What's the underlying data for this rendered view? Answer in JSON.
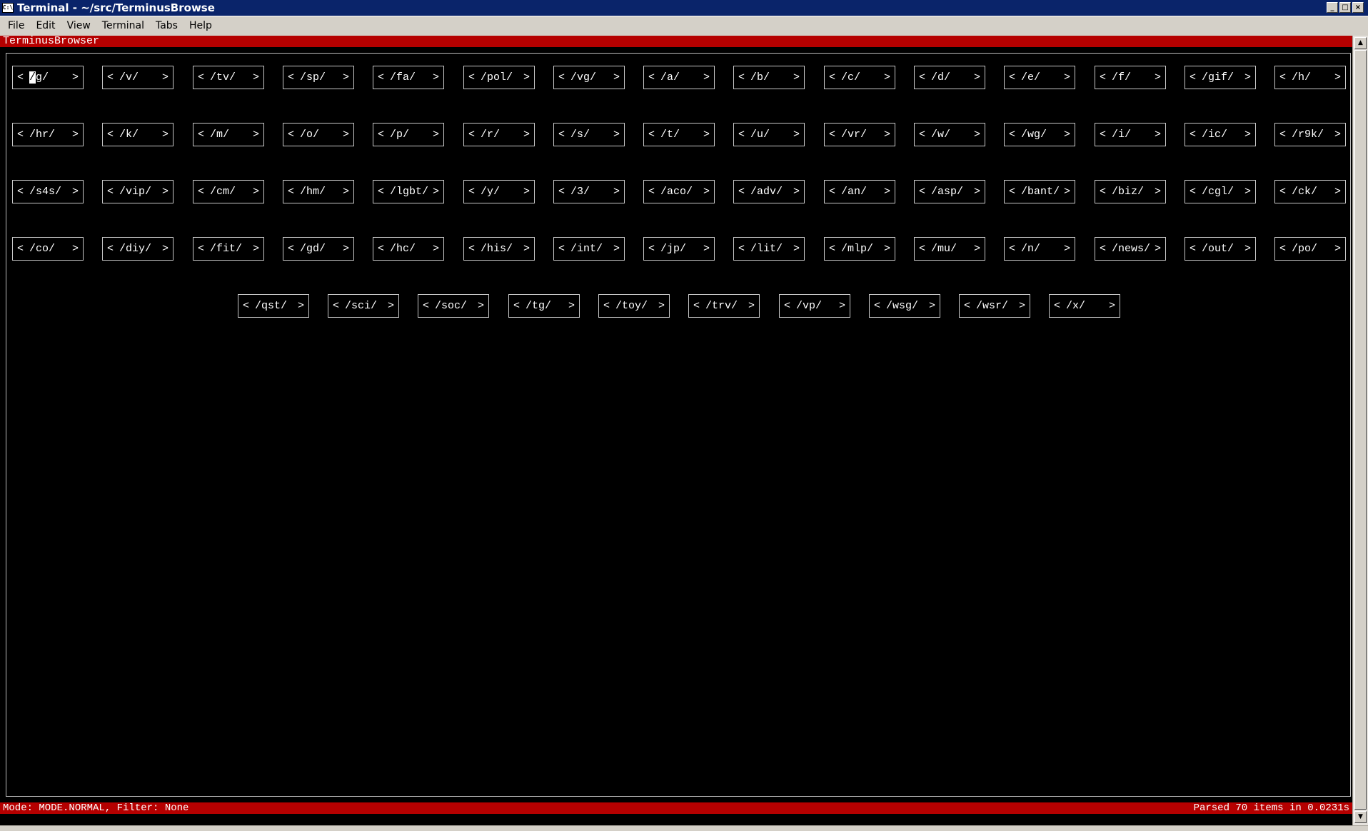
{
  "window": {
    "icon": "terminal-app-icon",
    "icon_glyph": "C:\\",
    "title": "Terminal - ~/src/TerminusBrowse",
    "controls": [
      "minimize",
      "maximize",
      "close"
    ],
    "minimize_glyph": "_",
    "maximize_glyph": "□",
    "close_glyph": "×"
  },
  "menu": [
    "File",
    "Edit",
    "View",
    "Terminal",
    "Tabs",
    "Help"
  ],
  "terminal": {
    "header": "TerminusBrowser",
    "status_left": "Mode: MODE.NORMAL, Filter: None",
    "status_right": "Parsed 70 items in 0.0231s",
    "boards": [
      [
        "/g/",
        "/v/",
        "/tv/",
        "/sp/",
        "/fa/",
        "/pol/",
        "/vg/",
        "/a/",
        "/b/",
        "/c/",
        "/d/",
        "/e/",
        "/f/",
        "/gif/",
        "/h/"
      ],
      [
        "/hr/",
        "/k/",
        "/m/",
        "/o/",
        "/p/",
        "/r/",
        "/s/",
        "/t/",
        "/u/",
        "/vr/",
        "/w/",
        "/wg/",
        "/i/",
        "/ic/",
        "/r9k/"
      ],
      [
        "/s4s/",
        "/vip/",
        "/cm/",
        "/hm/",
        "/lgbt/",
        "/y/",
        "/3/",
        "/aco/",
        "/adv/",
        "/an/",
        "/asp/",
        "/bant/",
        "/biz/",
        "/cgl/",
        "/ck/"
      ],
      [
        "/co/",
        "/diy/",
        "/fit/",
        "/gd/",
        "/hc/",
        "/his/",
        "/int/",
        "/jp/",
        "/lit/",
        "/mlp/",
        "/mu/",
        "/n/",
        "/news/",
        "/out/",
        "/po/"
      ],
      [
        "/qst/",
        "/sci/",
        "/soc/",
        "/tg/",
        "/toy/",
        "/trv/",
        "/vp/",
        "/wsg/",
        "/wsr/",
        "/x/"
      ]
    ],
    "selected": {
      "row": 0,
      "col": 0
    },
    "open_bracket": "<",
    "close_bracket": ">"
  },
  "scrollbar": {
    "up_glyph": "▲",
    "down_glyph": "▼"
  },
  "colors": {
    "titlebar": "#0a246a",
    "status_bar": "#b50000",
    "terminal_bg": "#000000",
    "terminal_fg": "#ffffff"
  }
}
